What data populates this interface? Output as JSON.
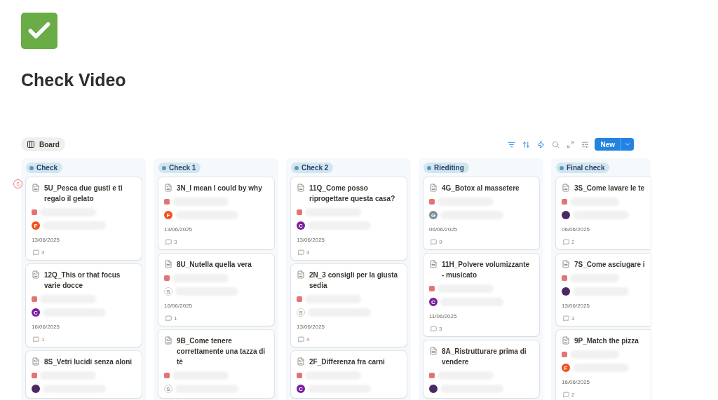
{
  "page": {
    "title": "Check Video"
  },
  "view_tab": {
    "label": "Board",
    "selected": true
  },
  "toolbar": {
    "new_button": "New"
  },
  "columns": [
    {
      "label": "Check",
      "cards": [
        {
          "title": "5U_Pesca due gusti e ti regalo il gelato",
          "marker": "S",
          "person": {
            "kind": "letter",
            "letter": "F",
            "color": "#f4511e"
          },
          "date": "13/06/2025",
          "comments": "3"
        },
        {
          "title": "12Q_This or that focus varie docce",
          "person": {
            "kind": "letter",
            "letter": "C",
            "color": "#7b1fa2"
          },
          "date": "16/06/2025",
          "comments": "1"
        },
        {
          "title": "8S_Vetri lucidi senza aloni",
          "person": {
            "kind": "photo"
          }
        }
      ]
    },
    {
      "label": "Check 1",
      "cards": [
        {
          "title": "3N_I mean I could by why",
          "person": {
            "kind": "letter",
            "letter": "F",
            "color": "#f4511e"
          },
          "date": "13/06/2025",
          "comments": "3"
        },
        {
          "title": "8U_Nutella quella vera",
          "person": {
            "kind": "outline",
            "letter": "S"
          },
          "date": "16/06/2025",
          "comments": "1"
        },
        {
          "title": "9B_Come tenere correttamente una tazza di tè",
          "person": {
            "kind": "outline",
            "letter": "S"
          }
        }
      ]
    },
    {
      "label": "Check 2",
      "cards": [
        {
          "title": "11Q_Come posso riprogettare questa casa?",
          "person": {
            "kind": "letter",
            "letter": "C",
            "color": "#7b1fa2"
          },
          "date": "13/06/2025",
          "comments": "3"
        },
        {
          "title": "2N_3 consigli per la giusta sedia",
          "person": {
            "kind": "outline",
            "letter": "S"
          },
          "date": "13/06/2025",
          "comments": "4"
        },
        {
          "title": "2F_Differenza fra carni",
          "person": {
            "kind": "letter",
            "letter": "C",
            "color": "#7b1fa2"
          }
        }
      ]
    },
    {
      "label": "Riediting",
      "cards": [
        {
          "title": "4G_Botox al massetere",
          "person": {
            "kind": "letter",
            "letter": "G",
            "color": "#78909c"
          },
          "date": "06/06/2025",
          "comments": "9"
        },
        {
          "title": "11H_Polvere volumizzante - musicato",
          "person": {
            "kind": "letter",
            "letter": "C",
            "color": "#7b1fa2"
          },
          "date": "11/06/2025",
          "comments": "3"
        },
        {
          "title": "8A_Ristrutturare prima di vendere",
          "person": {
            "kind": "photo"
          }
        }
      ]
    },
    {
      "label": "Final check",
      "cards": [
        {
          "title": "3S_Come lavare le te",
          "person": {
            "kind": "photo"
          },
          "date": "06/06/2025",
          "comments": "2"
        },
        {
          "title": "7S_Come asciugare i",
          "person": {
            "kind": "photo"
          },
          "date": "13/06/2025",
          "comments": "3"
        },
        {
          "title": "9P_Match the pizza",
          "person": {
            "kind": "letter",
            "letter": "F",
            "color": "#f4511e"
          },
          "date": "16/06/2025",
          "comments": "2"
        }
      ]
    }
  ]
}
